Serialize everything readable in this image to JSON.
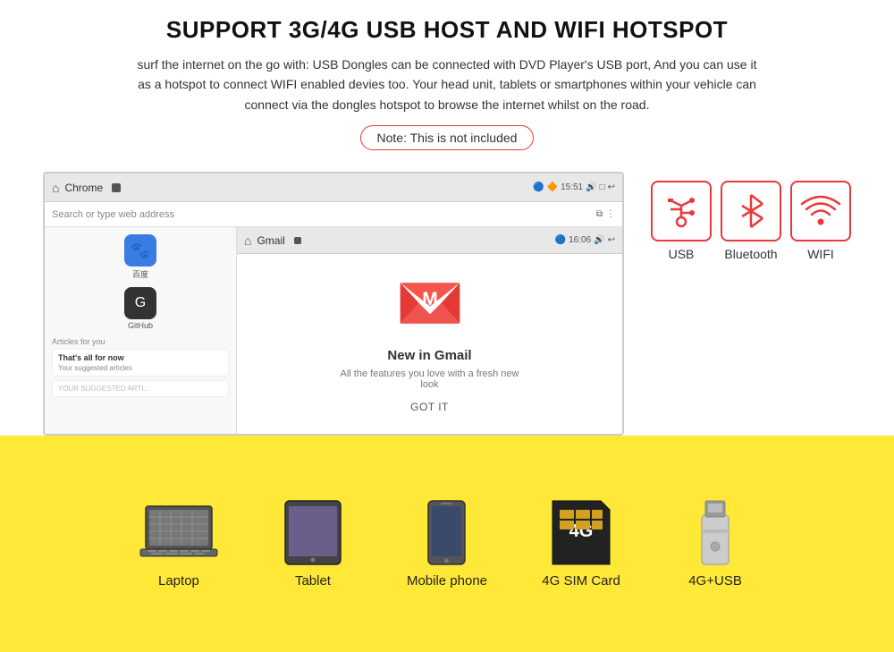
{
  "title": "SUPPORT 3G/4G USB HOST AND WIFI HOTSPOT",
  "description": "surf the internet on the go with: USB Dongles can be connected with DVD Player's USB port, And you can use it as a hotspot to connect WIFI enabled devies too. Your head unit, tablets or smartphones within your vehicle can connect via the dongles hotspot to browse the internet whilst on the road.",
  "note": "Note: This is not included",
  "chrome": {
    "title": "Chrome",
    "time": "15:51",
    "address_placeholder": "Search or type web address",
    "gmail_title": "Gmail",
    "gmail_time": "16:06"
  },
  "gmail": {
    "heading": "New in Gmail",
    "subtext": "All the features you love with a fresh new look",
    "button": "GOT IT"
  },
  "connectivity": [
    {
      "label": "USB",
      "icon": "usb-icon"
    },
    {
      "label": "Bluetooth",
      "icon": "bluetooth-icon"
    },
    {
      "label": "WIFI",
      "icon": "wifi-icon"
    }
  ],
  "devices": [
    {
      "label": "Laptop",
      "icon": "laptop-icon"
    },
    {
      "label": "Tablet",
      "icon": "tablet-icon"
    },
    {
      "label": "Mobile phone",
      "icon": "mobile-icon"
    },
    {
      "label": "4G SIM Card",
      "icon": "sim-icon"
    },
    {
      "label": "4G+USB",
      "icon": "usb-stick-icon"
    }
  ],
  "app_icons": [
    {
      "label": "百度",
      "bg": "#3b7ce4",
      "char": "🐾"
    },
    {
      "label": "GitHub",
      "bg": "#333",
      "char": "G"
    }
  ],
  "news": {
    "title": "That's all for now",
    "body": "Your suggested articles"
  }
}
